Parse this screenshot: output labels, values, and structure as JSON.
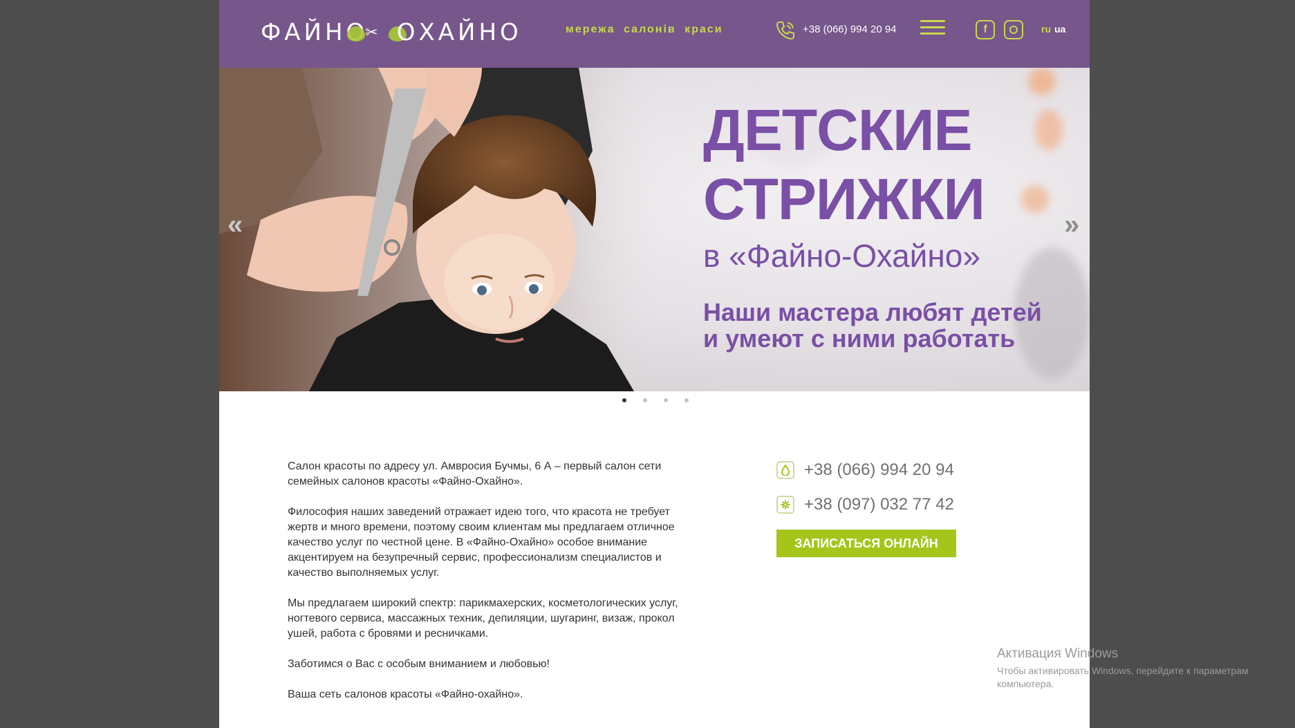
{
  "header": {
    "logo_left": "ФАЙНО",
    "logo_right": "ОХАЙНО",
    "tagline": "мережа салонів краси",
    "phone": "+38 (066) 994 20 94",
    "lang_ru": "ru",
    "lang_ua": "ua"
  },
  "slider": {
    "title_line1": "ДЕТСКИЕ",
    "title_line2": "СТРИЖКИ",
    "subtitle": "в «Файно-Охайно»",
    "text": "Наши мастера любят детей и умеют с ними работать",
    "prev": "«",
    "next": "»",
    "active_slide": 1,
    "slide_count": 4
  },
  "about": {
    "p1": "Салон красоты по адресу ул. Амвросия Бучмы, 6 А – первый салон сети семейных салонов красоты «Файно-Охайно».",
    "p2": "Философия наших заведений отражает идею того, что красота не требует жертв и много времени, поэтому своим клиентам мы предлагаем отличное качество услуг по честной цене. В «Файно-Охайно» особое внимание акцентируем на безупречный сервис, профессионализм специалистов и качество выполняемых услуг.",
    "p3": "Мы предлагаем широкий спектр: парикмахерских, косметологических услуг, ногтевого сервиса, массажных техник, депиляции, шугаринг, визаж, прокол ушей, работа с бровями и ресничками.",
    "p4": "Заботимся о Вас с особым вниманием и любовью!",
    "p5": "Ваша сеть салонов красоты «Файно-охайно»."
  },
  "contacts": {
    "phone1": "+38 (066) 994 20 94",
    "phone2": "+38 (097) 032 77 42",
    "cta": "ЗАПИСАТЬСЯ ОНЛАЙН"
  },
  "watermark": {
    "title": "Активация Windows",
    "text": "Чтобы активировать Windows, перейдите к параметрам компьютера."
  },
  "colors": {
    "header_bg": "#76568b",
    "accent_green": "#a6c51b",
    "title_purple": "#7a4fa6"
  }
}
